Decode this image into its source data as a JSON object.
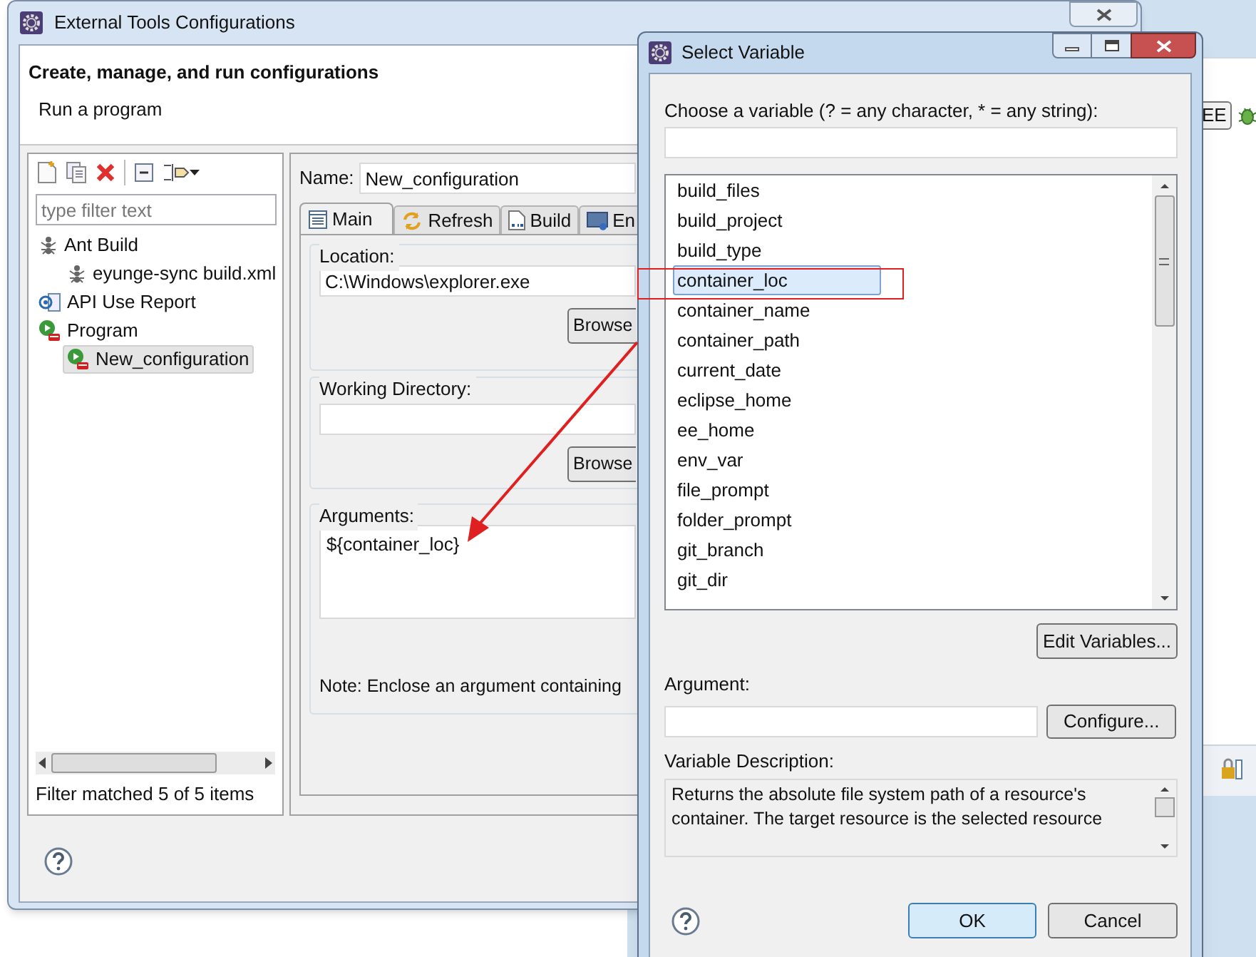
{
  "main_window": {
    "title": "External Tools Configurations",
    "heading": "Create, manage, and run configurations",
    "subheading": "Run a program",
    "tree_filter": {
      "placeholder": "type filter text"
    },
    "tree": [
      {
        "label": "Ant Build",
        "kind": "ant",
        "selected": false,
        "children": [
          {
            "label": "eyunge-sync build.xml",
            "kind": "ant",
            "selected": false
          }
        ]
      },
      {
        "label": "API Use Report",
        "kind": "api",
        "selected": false
      },
      {
        "label": "Program",
        "kind": "program",
        "selected": false,
        "children": [
          {
            "label": "New_configuration",
            "kind": "program",
            "selected": true
          }
        ]
      }
    ],
    "filter_status": "Filter matched 5 of 5 items",
    "name_label": "Name:",
    "name_value": "New_configuration",
    "tabs": [
      {
        "label": "Main",
        "kind": "main",
        "selected": true
      },
      {
        "label": "Refresh",
        "kind": "refresh",
        "selected": false
      },
      {
        "label": "Build",
        "kind": "build",
        "selected": false
      },
      {
        "label": "En",
        "kind": "environment",
        "selected": false
      }
    ],
    "location": {
      "label": "Location:",
      "value": "C:\\Windows\\explorer.exe",
      "button": "Browse"
    },
    "working_directory": {
      "label": "Working Directory:",
      "button": "Browse"
    },
    "arguments": {
      "label": "Arguments:",
      "value": "${container_loc}"
    },
    "note": "Note: Enclose an argument containing"
  },
  "background_window": {
    "button": "EE"
  },
  "dialog": {
    "title": "Select Variable",
    "prompt": "Choose a variable (? = any character, * = any string):",
    "variables": [
      {
        "label": "build_files",
        "selected": false
      },
      {
        "label": "build_project",
        "selected": false
      },
      {
        "label": "build_type",
        "selected": false
      },
      {
        "label": "container_loc",
        "selected": true
      },
      {
        "label": "container_name",
        "selected": false
      },
      {
        "label": "container_path",
        "selected": false
      },
      {
        "label": "current_date",
        "selected": false
      },
      {
        "label": "eclipse_home",
        "selected": false
      },
      {
        "label": "ee_home",
        "selected": false
      },
      {
        "label": "env_var",
        "selected": false
      },
      {
        "label": "file_prompt",
        "selected": false
      },
      {
        "label": "folder_prompt",
        "selected": false
      },
      {
        "label": "git_branch",
        "selected": false
      },
      {
        "label": "git_dir",
        "selected": false
      }
    ],
    "edit_button": "Edit Variables...",
    "argument_label": "Argument:",
    "configure_button": "Configure...",
    "description_label": "Variable Description:",
    "description": "Returns the absolute file system path of a resource's container. The target resource is the selected resource",
    "ok_button": "OK",
    "cancel_button": "Cancel"
  }
}
